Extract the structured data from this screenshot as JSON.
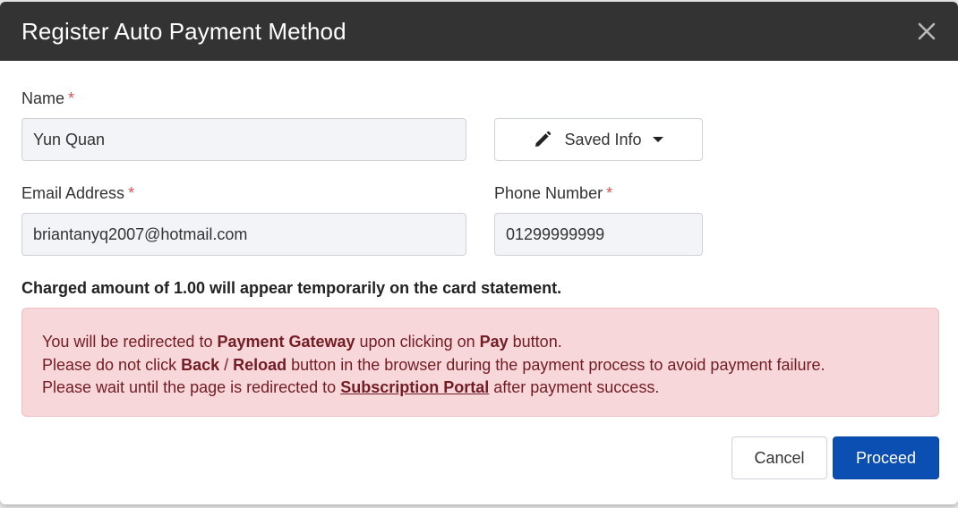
{
  "modal": {
    "title": "Register Auto Payment Method",
    "close_icon": "close-icon"
  },
  "form": {
    "name": {
      "label": "Name",
      "required_mark": "*",
      "value": "Yun Quan"
    },
    "saved_info": {
      "label": "Saved Info",
      "icon": "pencil-icon",
      "caret_icon": "caret-down-icon"
    },
    "email": {
      "label": "Email Address",
      "required_mark": "*",
      "value": "briantanyq2007@hotmail.com"
    },
    "phone": {
      "label": "Phone Number",
      "required_mark": "*",
      "value": "01299999999"
    }
  },
  "charge_note": "Charged amount of 1.00 will appear temporarily on the card statement.",
  "alert": {
    "line1": {
      "pre": "You will be redirected to ",
      "gateway": "Payment Gateway",
      "mid": " upon clicking on ",
      "pay": "Pay",
      "post": " button."
    },
    "line2": {
      "pre": "Please do not click ",
      "back": "Back",
      "sep": " / ",
      "reload": "Reload",
      "post": " button in the browser during the payment process to avoid payment failure."
    },
    "line3": {
      "pre": "Please wait until the page is redirected to ",
      "portal": "Subscription Portal",
      "post": " after payment success."
    }
  },
  "footer": {
    "cancel_label": "Cancel",
    "proceed_label": "Proceed"
  },
  "colors": {
    "header_bg": "#333333",
    "primary": "#0b4fb3",
    "required": "#d9534f",
    "alert_bg": "#f8d7da",
    "alert_text": "#721c24"
  }
}
